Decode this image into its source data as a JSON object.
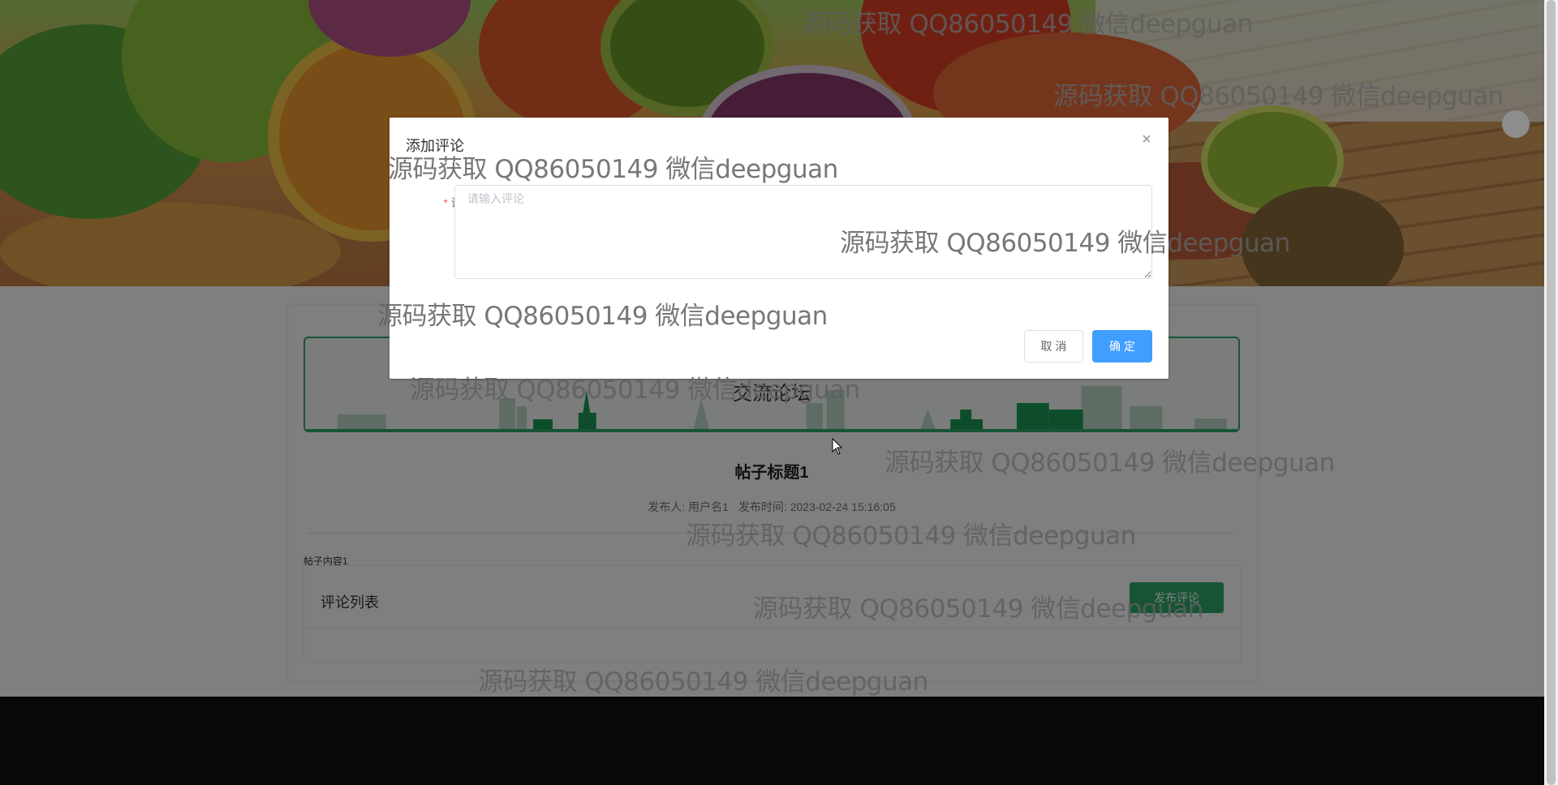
{
  "forum": {
    "banner_title": "交流论坛",
    "post_title": "帖子标题1",
    "publisher_label": "发布人:",
    "publisher": "用户名1",
    "publish_time_label": "发布时间:",
    "publish_time": "2023-02-24 15:16:05",
    "content": "帖子内容1",
    "comment_list_title": "评论列表",
    "publish_button": "发布评论"
  },
  "dialog": {
    "title": "添加评论",
    "close_icon": "×",
    "comment_label": "评论",
    "required_mark": "*",
    "comment_placeholder": "请输入评论",
    "comment_value": "",
    "cancel": "取 消",
    "confirm": "确 定"
  },
  "watermark": "源码获取 QQ86050149 微信deepguan",
  "colors": {
    "accent_green": "#2fa86b",
    "primary_blue": "#409eff",
    "footer": "#101010",
    "mask": "rgba(0,0,0,0.5)"
  },
  "icons": [
    "close-icon",
    "mouse-cursor-icon"
  ]
}
